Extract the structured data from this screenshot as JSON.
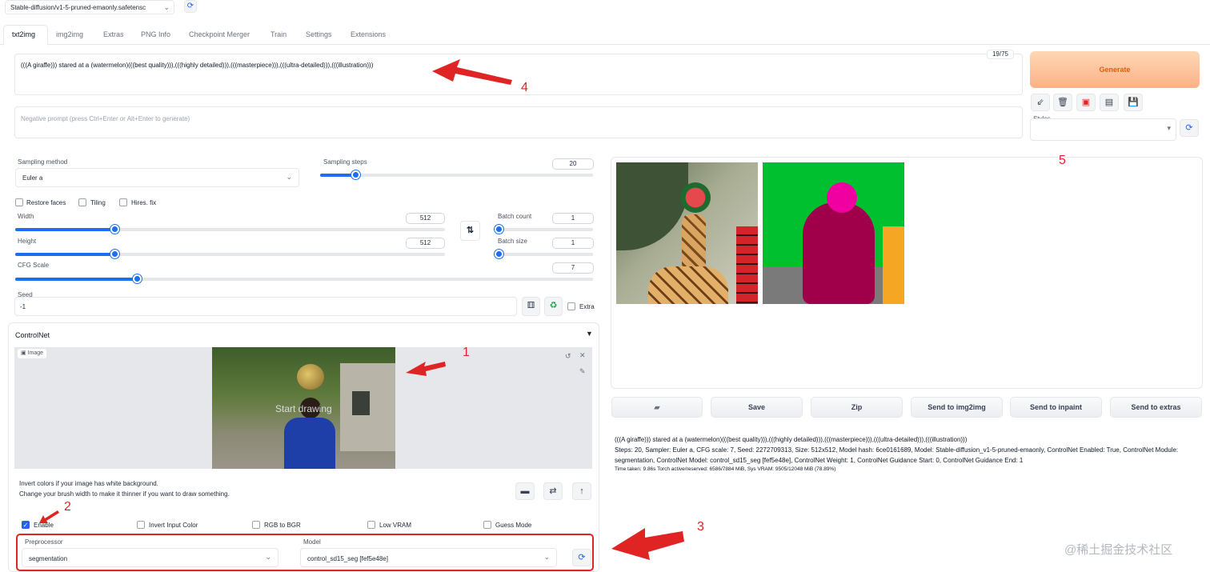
{
  "checkpoint": {
    "value": "Stable-diffusion/v1-5-pruned-emaonly.safetensc"
  },
  "tabs": [
    "txt2img",
    "img2img",
    "Extras",
    "PNG Info",
    "Checkpoint Merger",
    "Train",
    "Settings",
    "Extensions"
  ],
  "prompt": {
    "text": "(((A giraffe))) stared at a (watermelon)(((best quality))),(((highly detailed))),(((masterpiece))),(((ultra-detailed))),(((illustration)))",
    "token_count": "19/75",
    "negative_placeholder": "Negative prompt (press Ctrl+Enter or Alt+Enter to generate)"
  },
  "generate": {
    "label": "Generate",
    "styles_label": "Styles"
  },
  "sampling": {
    "method_label": "Sampling method",
    "method_value": "Euler a",
    "steps_label": "Sampling steps",
    "steps_value": "20",
    "steps_fraction": 0.13
  },
  "options": {
    "restore_faces": "Restore faces",
    "tiling": "Tiling",
    "hires_fix": "Hires. fix"
  },
  "size": {
    "width_label": "Width",
    "width_value": "512",
    "width_fraction": 0.23,
    "height_label": "Height",
    "height_value": "512",
    "height_fraction": 0.23,
    "batch_count_label": "Batch count",
    "batch_count_value": "1",
    "batch_size_label": "Batch size",
    "batch_size_value": "1"
  },
  "cfg": {
    "label": "CFG Scale",
    "value": "7",
    "fraction": 0.21
  },
  "seed": {
    "label": "Seed",
    "value": "-1",
    "extra_label": "Extra"
  },
  "controlnet": {
    "title": "ControlNet",
    "image_label": "Image",
    "canvas_overlay": "Start drawing",
    "help_line1": "Invert colors if your image has white background.",
    "help_line2": "Change your brush width to make it thinner if you want to draw something.",
    "enable_label": "Enable",
    "invert_label": "Invert Input Color",
    "rgb_label": "RGB to BGR",
    "lowvram_label": "Low VRAM",
    "guess_label": "Guess Mode",
    "preprocessor_label": "Preprocessor",
    "preprocessor_value": "segmentation",
    "model_label": "Model",
    "model_value": "control_sd15_seg [fef5e48e]"
  },
  "output_buttons": [
    "Save",
    "Zip",
    "Send to img2img",
    "Send to inpaint",
    "Send to extras"
  ],
  "info": {
    "prompt": "(((A giraffe))) stared at a (watermelon)(((best quality))),(((highly detailed))),(((masterpiece))),(((ultra-detailed))),(((illustration)))",
    "params_line1": "Steps: 20, Sampler: Euler a, CFG scale: 7, Seed: 2272709313, Size: 512x512, Model hash: 6ce0161689, Model: Stable-diffusion_v1-5-pruned-emaonly, ControlNet Enabled: True, ControlNet Module:",
    "params_line2": "segmentation, ControlNet Model: control_sd15_seg [fef5e48e], ControlNet Weight: 1, ControlNet Guidance Start: 0, ControlNet Guidance End: 1",
    "time": "Time taken: 9.86s  Torch active/reserved: 6586/7884 MiB, Sys VRAM: 9505/12048 MiB (78.89%)"
  },
  "annotations": [
    "1",
    "2",
    "3",
    "4",
    "5"
  ],
  "watermark": "@稀土掘金技术社区",
  "colors": {
    "accent": "#1d6ef2",
    "generate_bg": "#fdba8c",
    "generate_text": "#ea580c",
    "annotation": "#e02424",
    "seg_green": "#00c030",
    "seg_magenta": "#a0004a",
    "seg_pink": "#f000a0"
  }
}
